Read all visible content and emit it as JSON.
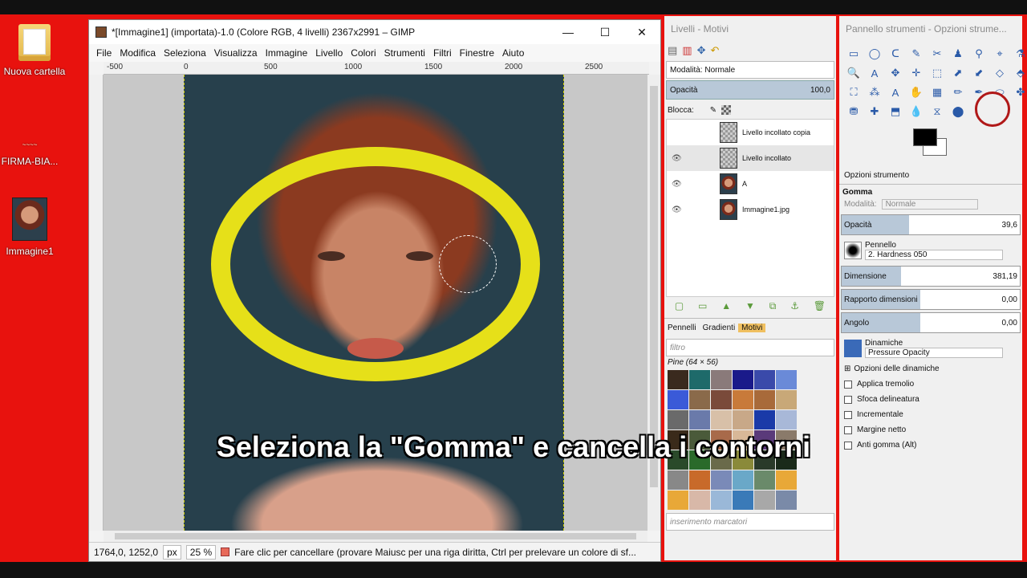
{
  "desktop": {
    "icons": [
      {
        "label": "Nuova cartella"
      },
      {
        "label": "FIRMA-BIA..."
      },
      {
        "label": "Immagine1"
      }
    ]
  },
  "image_window": {
    "title": "*[Immagine1] (importata)-1.0 (Colore RGB, 4 livelli) 2367x2991 – GIMP",
    "controls": {
      "minimize": "—",
      "maximize": "☐",
      "close": "✕"
    },
    "menu": [
      "File",
      "Modifica",
      "Seleziona",
      "Visualizza",
      "Immagine",
      "Livello",
      "Colori",
      "Strumenti",
      "Filtri",
      "Finestre",
      "Aiuto"
    ],
    "ruler_labels": [
      "-500",
      "0",
      "500",
      "1000",
      "1500",
      "2000",
      "2500"
    ],
    "status": {
      "coords": "1764,0, 1252,0",
      "unit": "px",
      "zoom": "25 %",
      "message": "Fare clic per cancellare (provare Maiusc per una riga diritta, Ctrl per prelevare un colore di sf..."
    }
  },
  "layers_panel": {
    "title": "Livelli - Motivi",
    "mode": "Modalità: Normale",
    "opacity_label": "Opacità",
    "opacity_value": "100,0",
    "lock_label": "Blocca:",
    "layers": [
      {
        "name": "Livello incollato copia",
        "visible": false,
        "thumb": "checker"
      },
      {
        "name": "Livello incollato",
        "visible": true,
        "thumb": "checker"
      },
      {
        "name": "A",
        "visible": true,
        "thumb": "face"
      },
      {
        "name": "Immagine1.jpg",
        "visible": true,
        "thumb": "face"
      }
    ],
    "tabs": [
      "Pennelli",
      "Gradienti",
      "Motivi"
    ],
    "filter_placeholder": "filtro",
    "pattern_name": "Pine (64 × 56)",
    "tags_placeholder": "inserimento marcatori",
    "pattern_colors": [
      "#3a2a1e",
      "#1e6a6a",
      "#8a7a7a",
      "#1a1a8a",
      "#3a4aaa",
      "#6a8ad8",
      "#3a5ad8",
      "#8a6a4a",
      "#7a4a3a",
      "#c87a3a",
      "#a86a3a",
      "#c8a878",
      "#6a6a6a",
      "#6a7aaa",
      "#d8c0a8",
      "#c8a888",
      "#1a3aa8",
      "#a8b8d8",
      "#3a2a1a",
      "#4a5a3a",
      "#a86a4a",
      "#d8b898",
      "#5a3a7a",
      "#8a7a6a",
      "#2a4a2a",
      "#2a6a2a",
      "#6a6a4a",
      "#8a8a3a",
      "#2a3a2a",
      "#1a2a1a",
      "#888888",
      "#c86a2a",
      "#7a8ab8",
      "#6aa8c8",
      "#6a8a6a",
      "#e8a838",
      "#e8a838",
      "#d8b8a8",
      "#9ab8d8",
      "#3a7ab8",
      "#a8a8a8",
      "#7a8aa8"
    ]
  },
  "tool_panel": {
    "title": "Pannello strumenti - Opzioni strume...",
    "tools": [
      "▭",
      "◯",
      "ᑕ",
      "✎",
      "✂",
      "♟",
      "⚲",
      "⌖",
      "⚗",
      "🔍",
      "A",
      "✥",
      "✛",
      "⬚",
      "⬈",
      "⬋",
      "◇",
      "⬘",
      "⛶",
      "⁂",
      "A",
      "✋",
      "▦",
      "✏",
      "✒",
      "⬭",
      "✤",
      "⛃",
      "✚",
      "⬒",
      "💧",
      "⧖",
      "⬤"
    ],
    "options_tab": "Opzioni strumento",
    "tool_name": "Gomma",
    "mode_label": "Modalità:",
    "mode_value": "Normale",
    "opacity": {
      "label": "Opacità",
      "value": "39,6"
    },
    "brush_label": "Pennello",
    "brush_value": "2. Hardness 050",
    "size": {
      "label": "Dimensione",
      "value": "381,19"
    },
    "ratio": {
      "label": "Rapporto dimensioni",
      "value": "0,00"
    },
    "angle": {
      "label": "Angolo",
      "value": "0,00"
    },
    "dynamics_label": "Dinamiche",
    "dynamics_value": "Pressure Opacity",
    "dynamics_options": "Opzioni delle dinamiche",
    "checkboxes": [
      "Applica tremolio",
      "Sfoca delineatura",
      "Incrementale",
      "Margine netto",
      "Anti gomma  (Alt)"
    ]
  },
  "caption": "Seleziona la \"Gomma\" e cancella i contorni"
}
